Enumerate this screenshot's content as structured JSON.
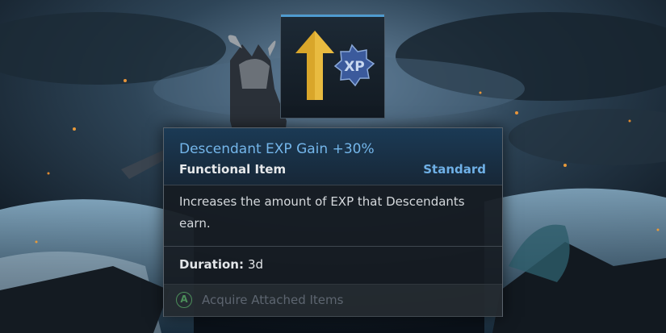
{
  "item": {
    "icon_name": "exp-boost-icon",
    "icon_badge_text": "XP",
    "name": "Descendant EXP Gain +30%",
    "type": "Functional Item",
    "grade": "Standard",
    "description": "Increases the amount of EXP that Descendants earn.",
    "duration_label": "Duration:",
    "duration_value": "3d"
  },
  "actions": {
    "acquire_button_glyph": "A",
    "acquire_label": "Acquire Attached Items"
  },
  "colors": {
    "name_text": "#74b6ea",
    "grade_text": "#6fb0e6",
    "icon_arrow": "#e0b030",
    "xp_badge": "#3b5a9c",
    "button_glyph": "#4c8e5a",
    "disabled_text": "#5d6570"
  }
}
